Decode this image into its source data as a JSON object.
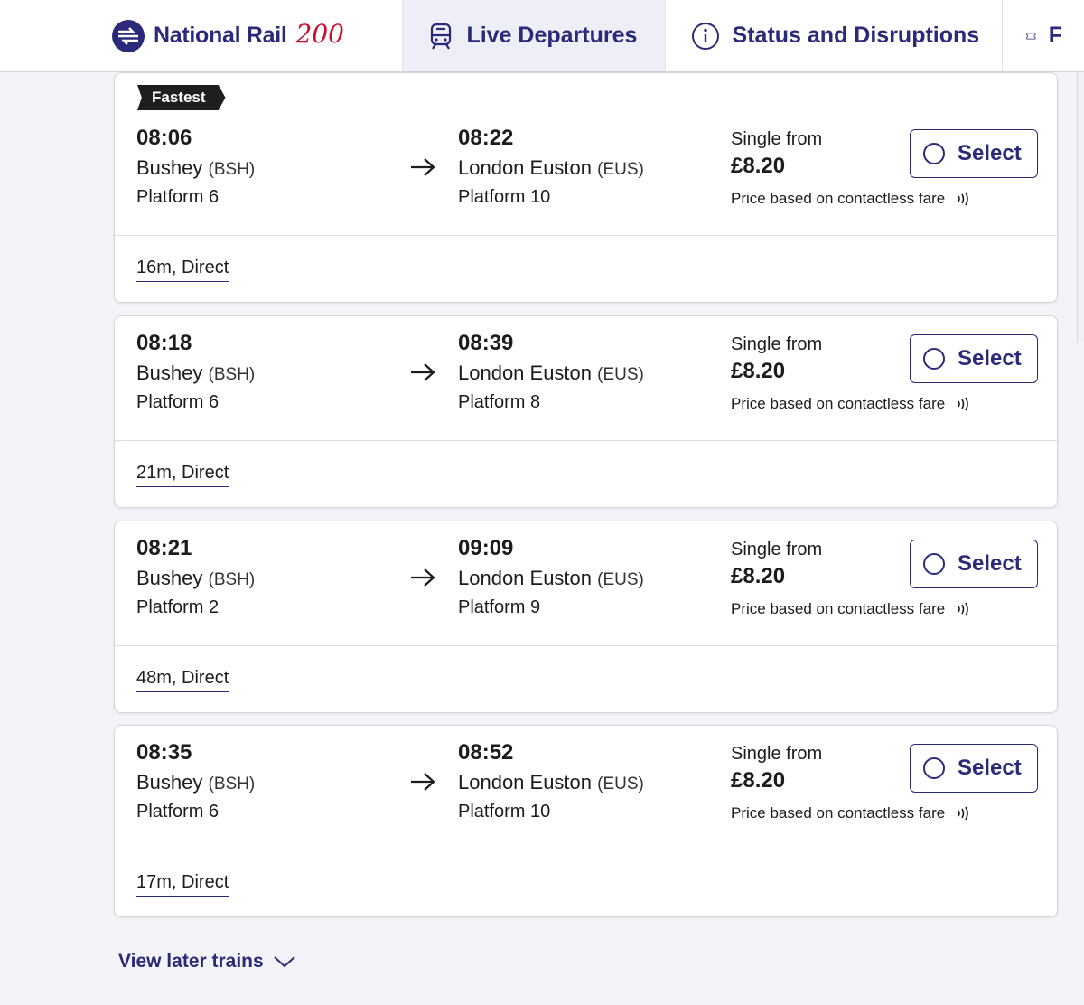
{
  "header": {
    "brand_name": "National Rail",
    "brand_anniversary": "200",
    "nav": [
      {
        "label": "Live Departures",
        "active": true
      },
      {
        "label": "Status and Disruptions",
        "active": false
      },
      {
        "label": "F",
        "active": false
      }
    ]
  },
  "colors": {
    "brand": "#2b2a7a",
    "anniversary": "#c8102e",
    "badge": "#1e1e1e"
  },
  "journeys": [
    {
      "badge": "Fastest",
      "depart_time": "08:06",
      "depart_station": "Bushey",
      "depart_code": "(BSH)",
      "depart_platform": "Platform 6",
      "arrive_time": "08:22",
      "arrive_station": "London Euston",
      "arrive_code": "(EUS)",
      "arrive_platform": "Platform 10",
      "price_label": "Single from",
      "price": "£8.20",
      "fare_note": "Price based on contactless fare",
      "select_label": "Select",
      "summary": "16m, Direct"
    },
    {
      "badge": "",
      "depart_time": "08:18",
      "depart_station": "Bushey",
      "depart_code": "(BSH)",
      "depart_platform": "Platform 6",
      "arrive_time": "08:39",
      "arrive_station": "London Euston",
      "arrive_code": "(EUS)",
      "arrive_platform": "Platform 8",
      "price_label": "Single from",
      "price": "£8.20",
      "fare_note": "Price based on contactless fare",
      "select_label": "Select",
      "summary": "21m, Direct"
    },
    {
      "badge": "",
      "depart_time": "08:21",
      "depart_station": "Bushey",
      "depart_code": "(BSH)",
      "depart_platform": "Platform 2",
      "arrive_time": "09:09",
      "arrive_station": "London Euston",
      "arrive_code": "(EUS)",
      "arrive_platform": "Platform 9",
      "price_label": "Single from",
      "price": "£8.20",
      "fare_note": "Price based on contactless fare",
      "select_label": "Select",
      "summary": "48m, Direct"
    },
    {
      "badge": "",
      "depart_time": "08:35",
      "depart_station": "Bushey",
      "depart_code": "(BSH)",
      "depart_platform": "Platform 6",
      "arrive_time": "08:52",
      "arrive_station": "London Euston",
      "arrive_code": "(EUS)",
      "arrive_platform": "Platform 10",
      "price_label": "Single from",
      "price": "£8.20",
      "fare_note": "Price based on contactless fare",
      "select_label": "Select",
      "summary": "17m, Direct"
    }
  ],
  "footer": {
    "later_label": "View later trains"
  }
}
